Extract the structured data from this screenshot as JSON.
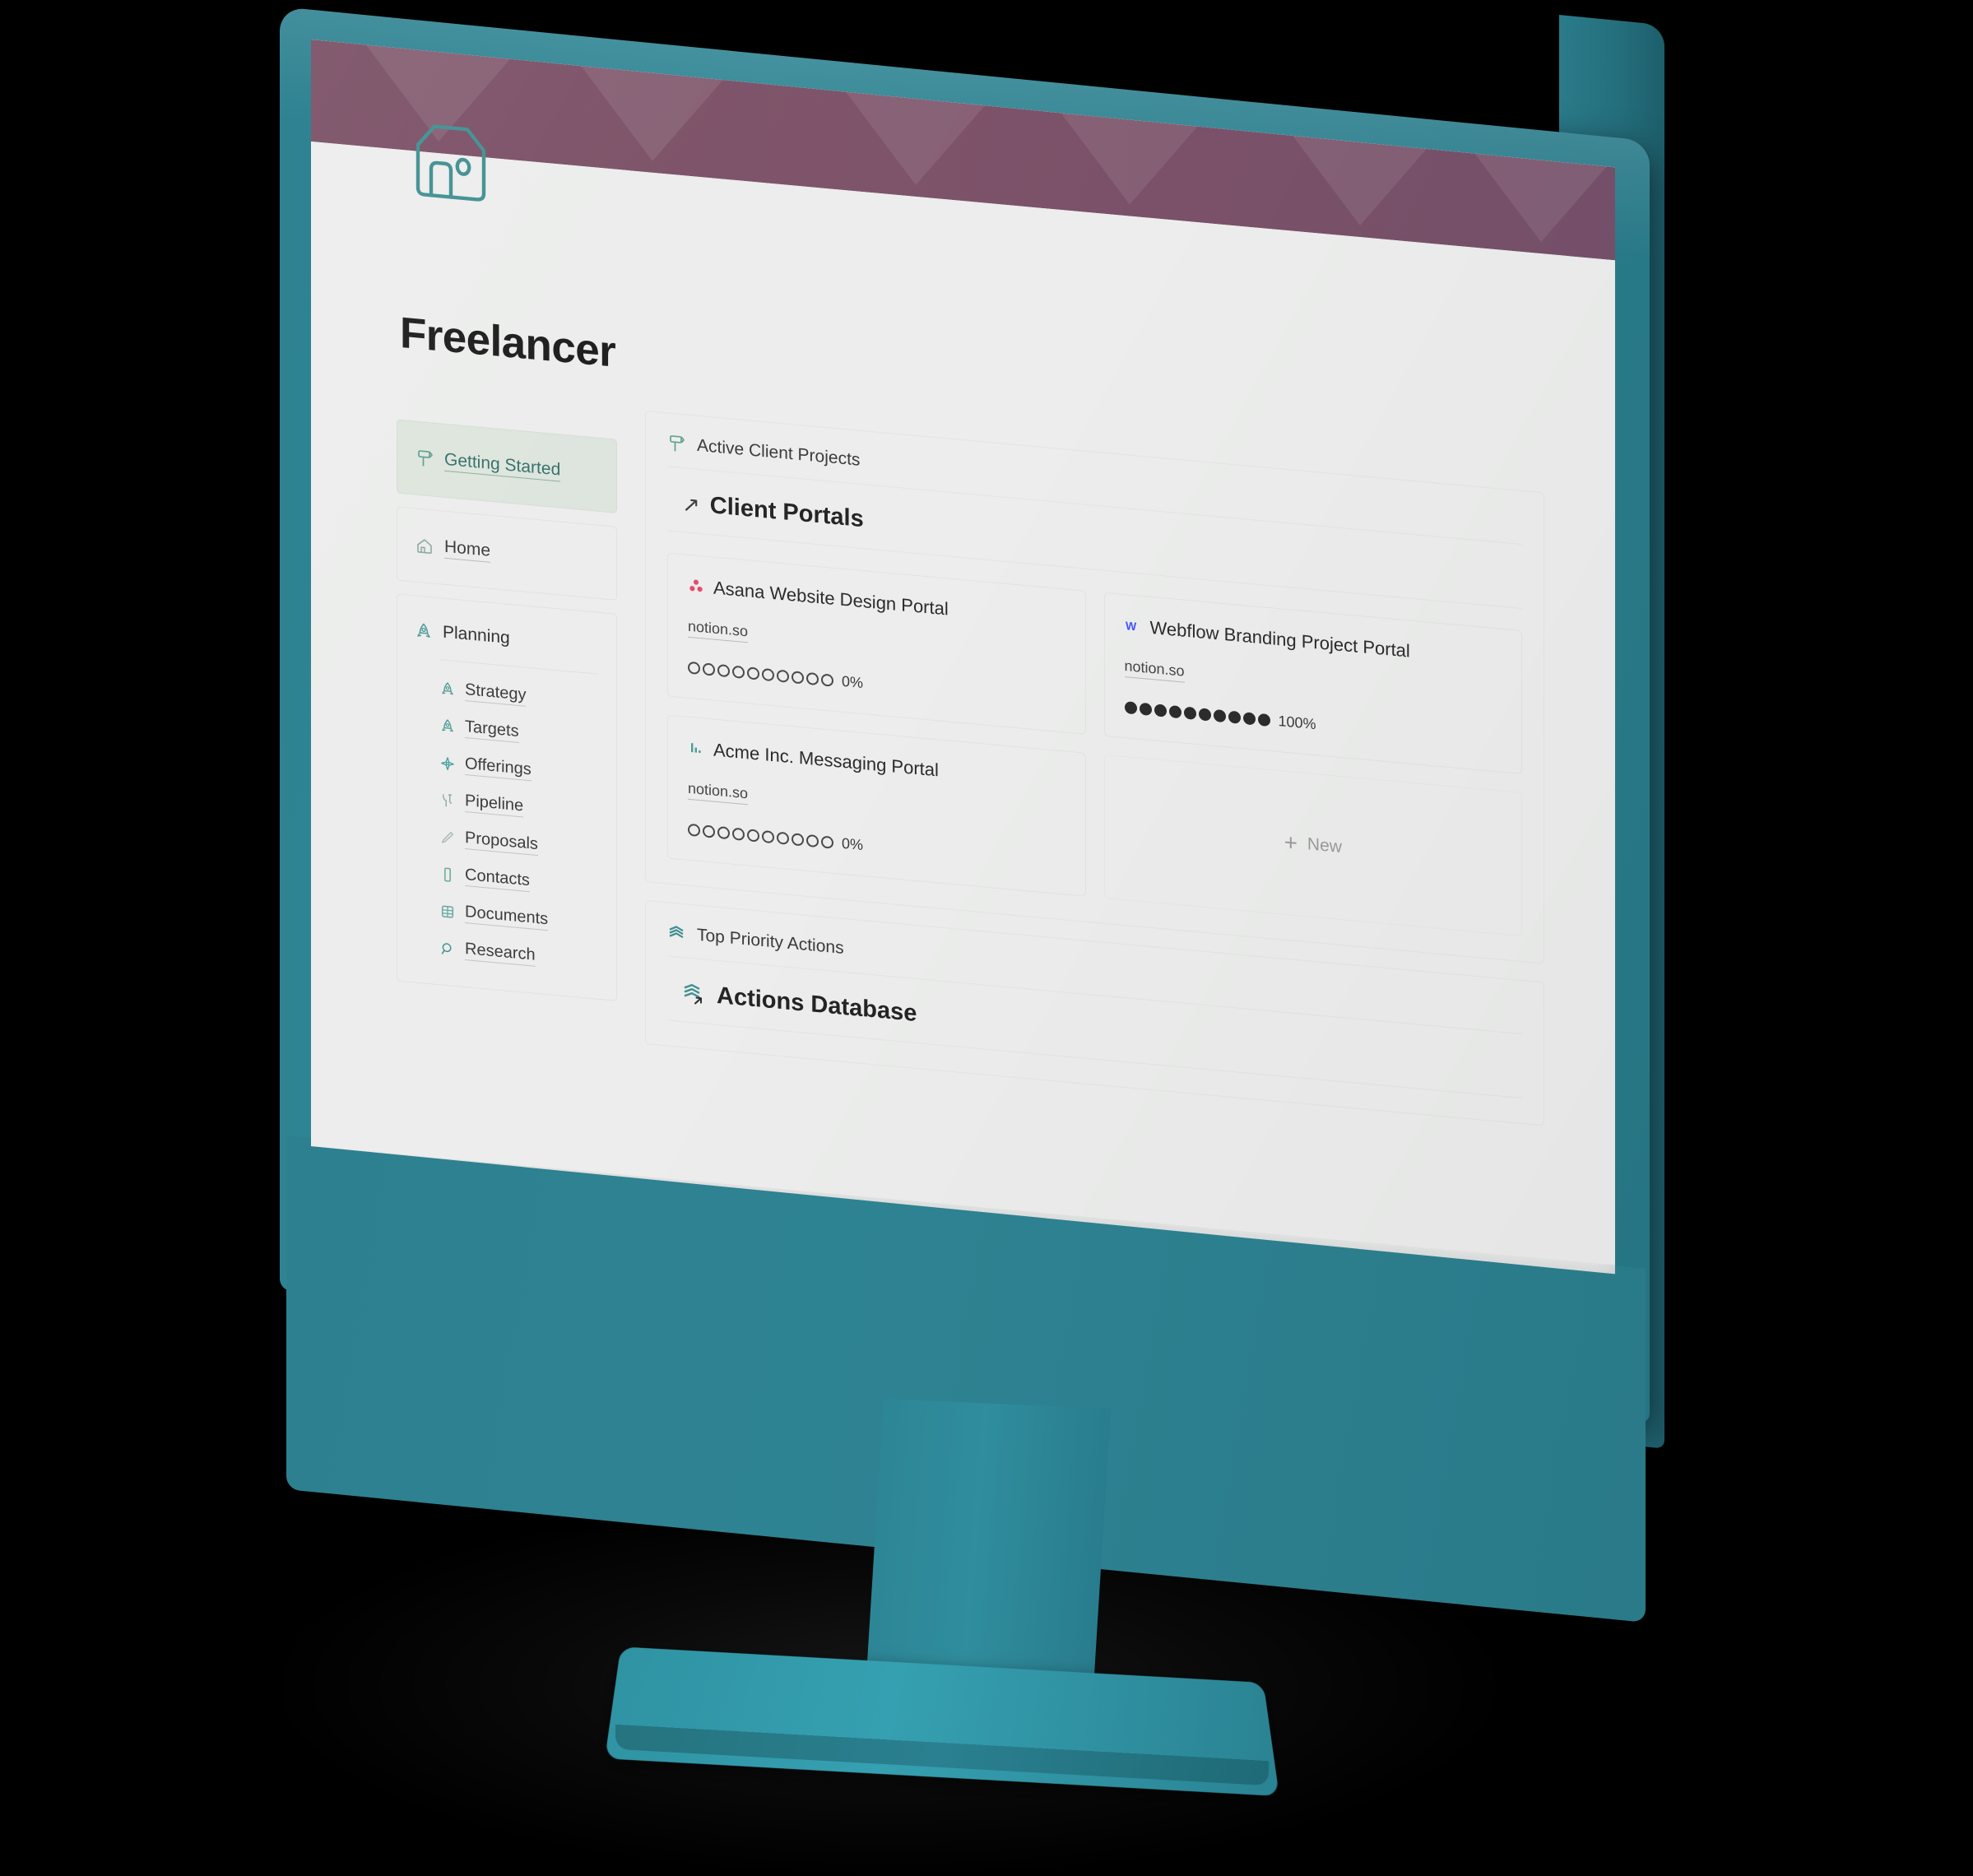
{
  "header": {
    "logo_icon": "notion-house-tag-logo",
    "banner_color": "#7a4f65",
    "chevron_color": "#8e6b7c"
  },
  "page": {
    "title": "Freelancer",
    "background_color": "#ecedec"
  },
  "sidebar": {
    "primary": [
      {
        "label": "Getting Started",
        "icon": "signpost-icon",
        "active": true
      },
      {
        "label": "Home",
        "icon": "house-icon",
        "active": false
      }
    ],
    "group": {
      "label": "Planning",
      "icon": "rocket-icon",
      "items": [
        {
          "label": "Strategy",
          "icon": "rocket-icon"
        },
        {
          "label": "Targets",
          "icon": "rocket-icon"
        },
        {
          "label": "Offerings",
          "icon": "sparkle-icon"
        },
        {
          "label": "Pipeline",
          "icon": "funnel-icon"
        },
        {
          "label": "Proposals",
          "icon": "pencil-icon"
        },
        {
          "label": "Contacts",
          "icon": "hexagon-icon"
        },
        {
          "label": "Documents",
          "icon": "grid-table-icon"
        },
        {
          "label": "Research",
          "icon": "magnifier-icon"
        }
      ]
    }
  },
  "main": {
    "sections": [
      {
        "heading": "Active Client Projects",
        "heading_icon": "signpost-icon",
        "database": {
          "name": "Client Portals",
          "icon": "diagonal-arrow-icon"
        },
        "cards": [
          {
            "title": "Asana Website Design Portal",
            "icon": "asana-logo",
            "icon_color": "#e8486b",
            "url": "notion.so",
            "progress_label": "0%",
            "progress_filled": 0,
            "progress_total": 10
          },
          {
            "title": "Webflow Branding Project Portal",
            "icon": "webflow-logo",
            "icon_color": "#4353ff",
            "url": "notion.so",
            "progress_label": "100%",
            "progress_filled": 10,
            "progress_total": 10
          },
          {
            "title": "Acme Inc. Messaging Portal",
            "icon": "bar-chart-icon",
            "icon_color": "#4f9a96",
            "url": "notion.so",
            "progress_label": "0%",
            "progress_filled": 0,
            "progress_total": 10
          }
        ],
        "new_button": {
          "label": "New",
          "icon": "plus-icon"
        }
      },
      {
        "heading": "Top Priority Actions",
        "heading_icon": "stacked-layers-icon",
        "database": {
          "name": "Actions Database",
          "icon": "stacked-layers-arrow-icon"
        }
      }
    ]
  },
  "device": {
    "type": "desktop-monitor",
    "frame_color": "#2e8291",
    "stand_color": "#2f93a3"
  }
}
